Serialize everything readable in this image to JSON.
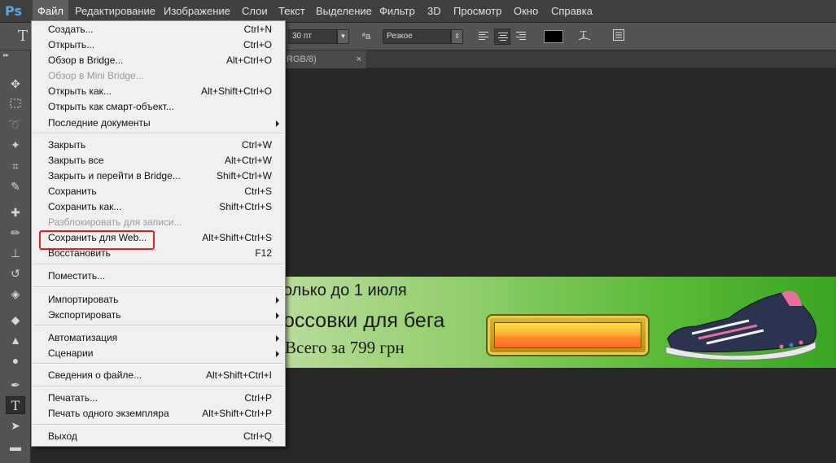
{
  "app": {
    "logo": "Ps"
  },
  "menubar": {
    "items": [
      "Файл",
      "Редактирование",
      "Изображение",
      "Слои",
      "Текст",
      "Выделение",
      "Фильтр",
      "3D",
      "Просмотр",
      "Окно",
      "Справка"
    ],
    "active_index": 0
  },
  "options_bar": {
    "tool_icon": "type-tool-icon",
    "font_size": "30 пт",
    "aa_icon": "anti-alias-icon",
    "aa_label": "ªa",
    "aa_method": "Резкое",
    "align": [
      "align-left-icon",
      "align-center-icon",
      "align-right-icon"
    ],
    "align_active": 1,
    "text_color": "#000000"
  },
  "tabs": {
    "document": {
      "title": "RGB/8)",
      "close": "×"
    }
  },
  "toolbox": {
    "collapse_glyph": "▸▸",
    "tools": [
      "move-tool-icon",
      "marquee-tool-icon",
      "lasso-tool-icon",
      "magic-wand-tool-icon",
      "crop-tool-icon",
      "eyedropper-tool-icon",
      "healing-brush-tool-icon",
      "brush-tool-icon",
      "clone-stamp-tool-icon",
      "history-brush-tool-icon",
      "eraser-tool-icon",
      "paint-bucket-tool-icon",
      "blur-tool-icon",
      "dodge-tool-icon",
      "pen-tool-icon",
      "type-tool-icon",
      "path-selection-tool-icon",
      "rectangle-tool-icon"
    ],
    "active_index": 15
  },
  "file_menu": {
    "items": [
      {
        "label": "Создать...",
        "shortcut": "Ctrl+N"
      },
      {
        "label": "Открыть...",
        "shortcut": "Ctrl+O"
      },
      {
        "label": "Обзор в Bridge...",
        "shortcut": "Alt+Ctrl+O"
      },
      {
        "label": "Обзор в Mini Bridge...",
        "shortcut": "",
        "disabled": true
      },
      {
        "label": "Открыть как...",
        "shortcut": "Alt+Shift+Ctrl+O"
      },
      {
        "label": "Открыть как смарт-объект...",
        "shortcut": ""
      },
      {
        "label": "Последние документы",
        "shortcut": "",
        "submenu": true
      },
      {
        "label": "Закрыть",
        "shortcut": "Ctrl+W"
      },
      {
        "label": "Закрыть все",
        "shortcut": "Alt+Ctrl+W"
      },
      {
        "label": "Закрыть и перейти в Bridge...",
        "shortcut": "Shift+Ctrl+W"
      },
      {
        "label": "Сохранить",
        "shortcut": "Ctrl+S"
      },
      {
        "label": "Сохранить как...",
        "shortcut": "Shift+Ctrl+S"
      },
      {
        "label": "Разблокировать для записи...",
        "shortcut": "",
        "disabled": true
      },
      {
        "label": "Сохранить для Web...",
        "shortcut": "Alt+Shift+Ctrl+S",
        "highlighted": true
      },
      {
        "label": "Восстановить",
        "shortcut": "F12"
      },
      {
        "label": "Поместить...",
        "shortcut": ""
      },
      {
        "label": "Импортировать",
        "shortcut": "",
        "submenu": true
      },
      {
        "label": "Экспортировать",
        "shortcut": "",
        "submenu": true
      },
      {
        "label": "Автоматизация",
        "shortcut": "",
        "submenu": true
      },
      {
        "label": "Сценарии",
        "shortcut": "",
        "submenu": true
      },
      {
        "label": "Сведения о файле...",
        "shortcut": "Alt+Shift+Ctrl+I"
      },
      {
        "label": "Печатать...",
        "shortcut": "Ctrl+P"
      },
      {
        "label": "Печать одного экземпляра",
        "shortcut": "Alt+Shift+Ctrl+P"
      },
      {
        "label": "Выход",
        "shortcut": "Ctrl+Q"
      }
    ]
  },
  "banner": {
    "line1": "олько до 1 июля",
    "line2": "оссовки для бега",
    "line3": "Всего за 799 грн"
  },
  "colors": {
    "highlight_box": "#e0242d",
    "menu_bg": "#f0f0f0",
    "ui_dark": "#282828"
  }
}
